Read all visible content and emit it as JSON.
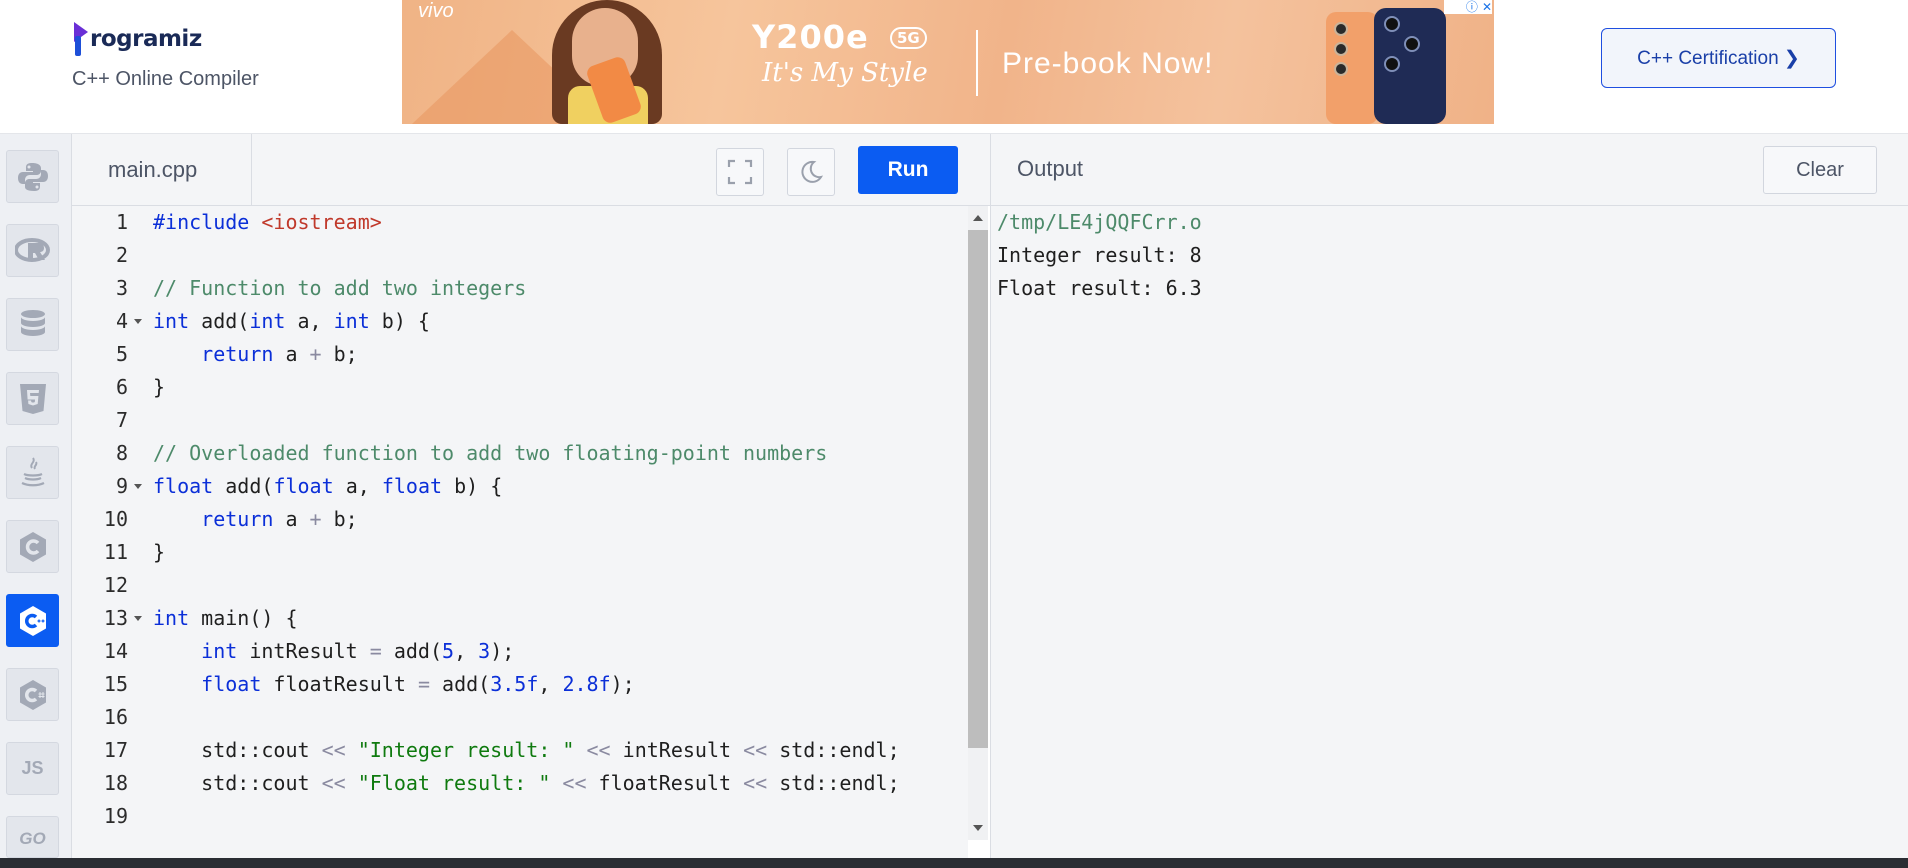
{
  "header": {
    "logo_text": "rogramiz",
    "subtitle": "C++ Online Compiler",
    "certification_button": "C++ Certification ❯"
  },
  "ad": {
    "brand": "vivo",
    "model": "Y200e",
    "badge": "5G",
    "tagline": "It's My Style",
    "cta": "Pre-book Now!",
    "info_icon": "ⓘ",
    "close_icon": "✕"
  },
  "sidebar": {
    "items": [
      {
        "name": "python",
        "icon": "python-icon"
      },
      {
        "name": "r",
        "icon": "r-icon"
      },
      {
        "name": "sql",
        "icon": "database-icon"
      },
      {
        "name": "html",
        "icon": "html5-icon"
      },
      {
        "name": "java",
        "icon": "java-icon"
      },
      {
        "name": "c",
        "icon": "c-icon"
      },
      {
        "name": "cpp",
        "icon": "cpp-icon",
        "active": true
      },
      {
        "name": "csharp",
        "icon": "csharp-icon"
      },
      {
        "name": "js",
        "label": "JS",
        "icon": "js-icon"
      },
      {
        "name": "go",
        "label": "GO",
        "icon": "go-icon"
      }
    ]
  },
  "editor": {
    "file_tab": "main.cpp",
    "run_label": "Run",
    "line_numbers": [
      "1",
      "2",
      "3",
      "4",
      "5",
      "6",
      "7",
      "8",
      "9",
      "10",
      "11",
      "12",
      "13",
      "14",
      "15",
      "16",
      "17",
      "18",
      "19"
    ]
  },
  "output": {
    "title": "Output",
    "clear_label": "Clear",
    "lines": [
      "/tmp/LE4jQQFCrr.o",
      "Integer result: 8",
      "Float result: 6.3"
    ]
  },
  "colors": {
    "accent": "#0b5cf2",
    "comment": "#4d8a6a",
    "keyword": "#0b2fd8",
    "string": "#0f7a0f",
    "include": "#c0392b"
  }
}
